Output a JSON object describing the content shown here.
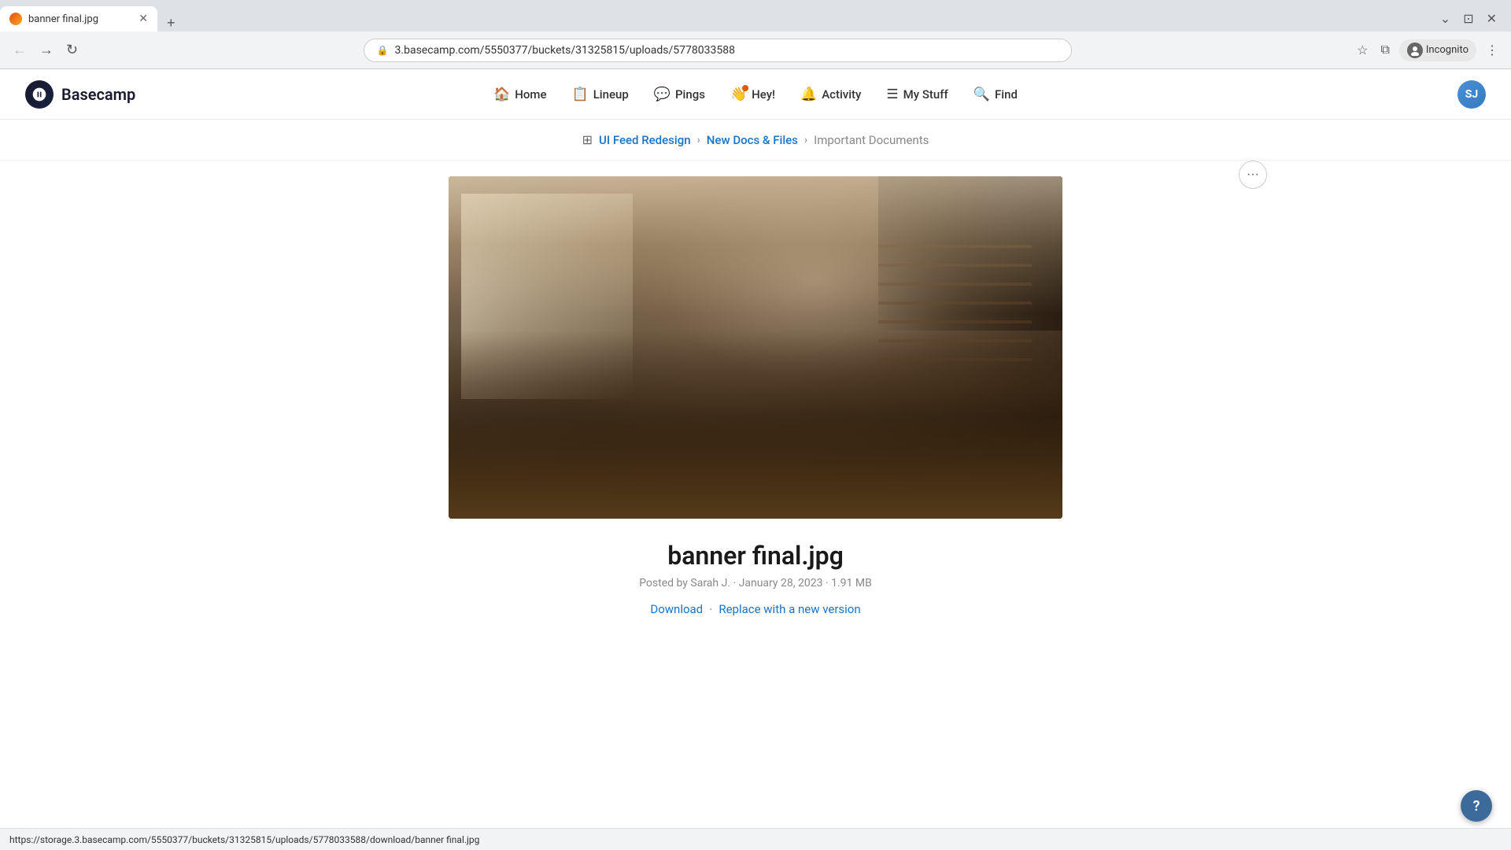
{
  "browser": {
    "tab_title": "banner final.jpg",
    "tab_favicon_alt": "basecamp favicon",
    "url": "3.basecamp.com/5550377/buckets/31325815/uploads/5778033588",
    "url_full": "https://3.basecamp.com/5550377/buckets/31325815/uploads/5778033588",
    "incognito_label": "Incognito"
  },
  "nav": {
    "logo_text": "Basecamp",
    "items": [
      {
        "id": "home",
        "label": "Home",
        "icon": "🏠"
      },
      {
        "id": "lineup",
        "label": "Lineup",
        "icon": "📋"
      },
      {
        "id": "pings",
        "label": "Pings",
        "icon": "💬"
      },
      {
        "id": "hey",
        "label": "Hey!",
        "icon": "👋"
      },
      {
        "id": "activity",
        "label": "Activity",
        "icon": "🔔"
      },
      {
        "id": "mystuff",
        "label": "My Stuff",
        "icon": "☰"
      },
      {
        "id": "find",
        "label": "Find",
        "icon": "🔍"
      }
    ],
    "user_initials": "SJ"
  },
  "breadcrumb": {
    "project_name": "UI Feed Redesign",
    "section_name": "New Docs & Files",
    "current_page": "Important Documents",
    "separator": "›"
  },
  "file": {
    "title": "banner final.jpg",
    "posted_by": "Posted by Sarah J.",
    "date": "January 28, 2023",
    "size": "1.91 MB",
    "dot_separator": "·",
    "download_label": "Download",
    "replace_label": "Replace with a new version",
    "action_separator": "·"
  },
  "overflow_menu": {
    "label": "···"
  },
  "status_bar": {
    "url": "https://storage.3.basecamp.com/5550377/buckets/31325815/uploads/5778033588/download/banner final.jpg"
  },
  "help": {
    "label": "?"
  }
}
